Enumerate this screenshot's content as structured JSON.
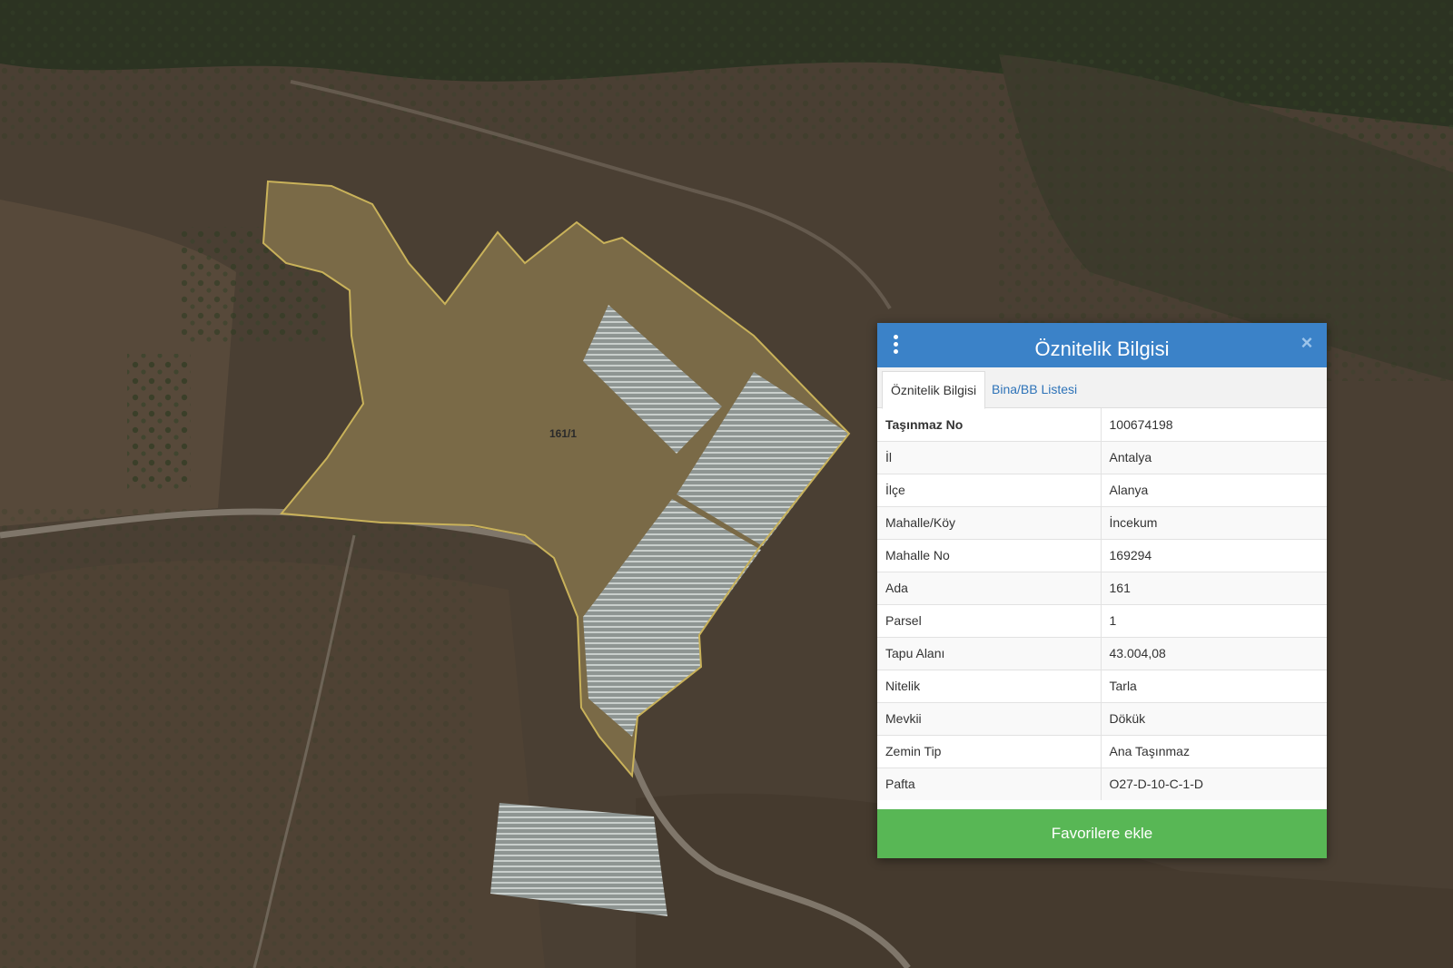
{
  "map": {
    "parcel_label": "161/1"
  },
  "panel": {
    "title": "Öznitelik Bilgisi",
    "menu_icon": "kebab-menu-icon",
    "close_icon": "close-icon",
    "close_glyph": "×",
    "tabs": [
      {
        "label": "Öznitelik Bilgisi",
        "active": true
      },
      {
        "label": "Bina/BB Listesi",
        "active": false
      }
    ],
    "rows": [
      {
        "key": "Taşınmaz No",
        "value": "100674198"
      },
      {
        "key": "İl",
        "value": "Antalya"
      },
      {
        "key": "İlçe",
        "value": "Alanya"
      },
      {
        "key": "Mahalle/Köy",
        "value": "İncekum"
      },
      {
        "key": "Mahalle No",
        "value": "169294"
      },
      {
        "key": "Ada",
        "value": "161"
      },
      {
        "key": "Parsel",
        "value": "1"
      },
      {
        "key": "Tapu Alanı",
        "value": "43.004,08"
      },
      {
        "key": "Nitelik",
        "value": "Tarla"
      },
      {
        "key": "Mevkii",
        "value": "Dökük"
      },
      {
        "key": "Zemin Tip",
        "value": "Ana Taşınmaz"
      },
      {
        "key": "Pafta",
        "value": "O27-D-10-C-1-D"
      }
    ],
    "favorite_button": "Favorilere ekle"
  },
  "colors": {
    "header": "#3b82c8",
    "button": "#58b755",
    "parcel_outline": "#c9b25a",
    "link": "#2e73b8"
  }
}
